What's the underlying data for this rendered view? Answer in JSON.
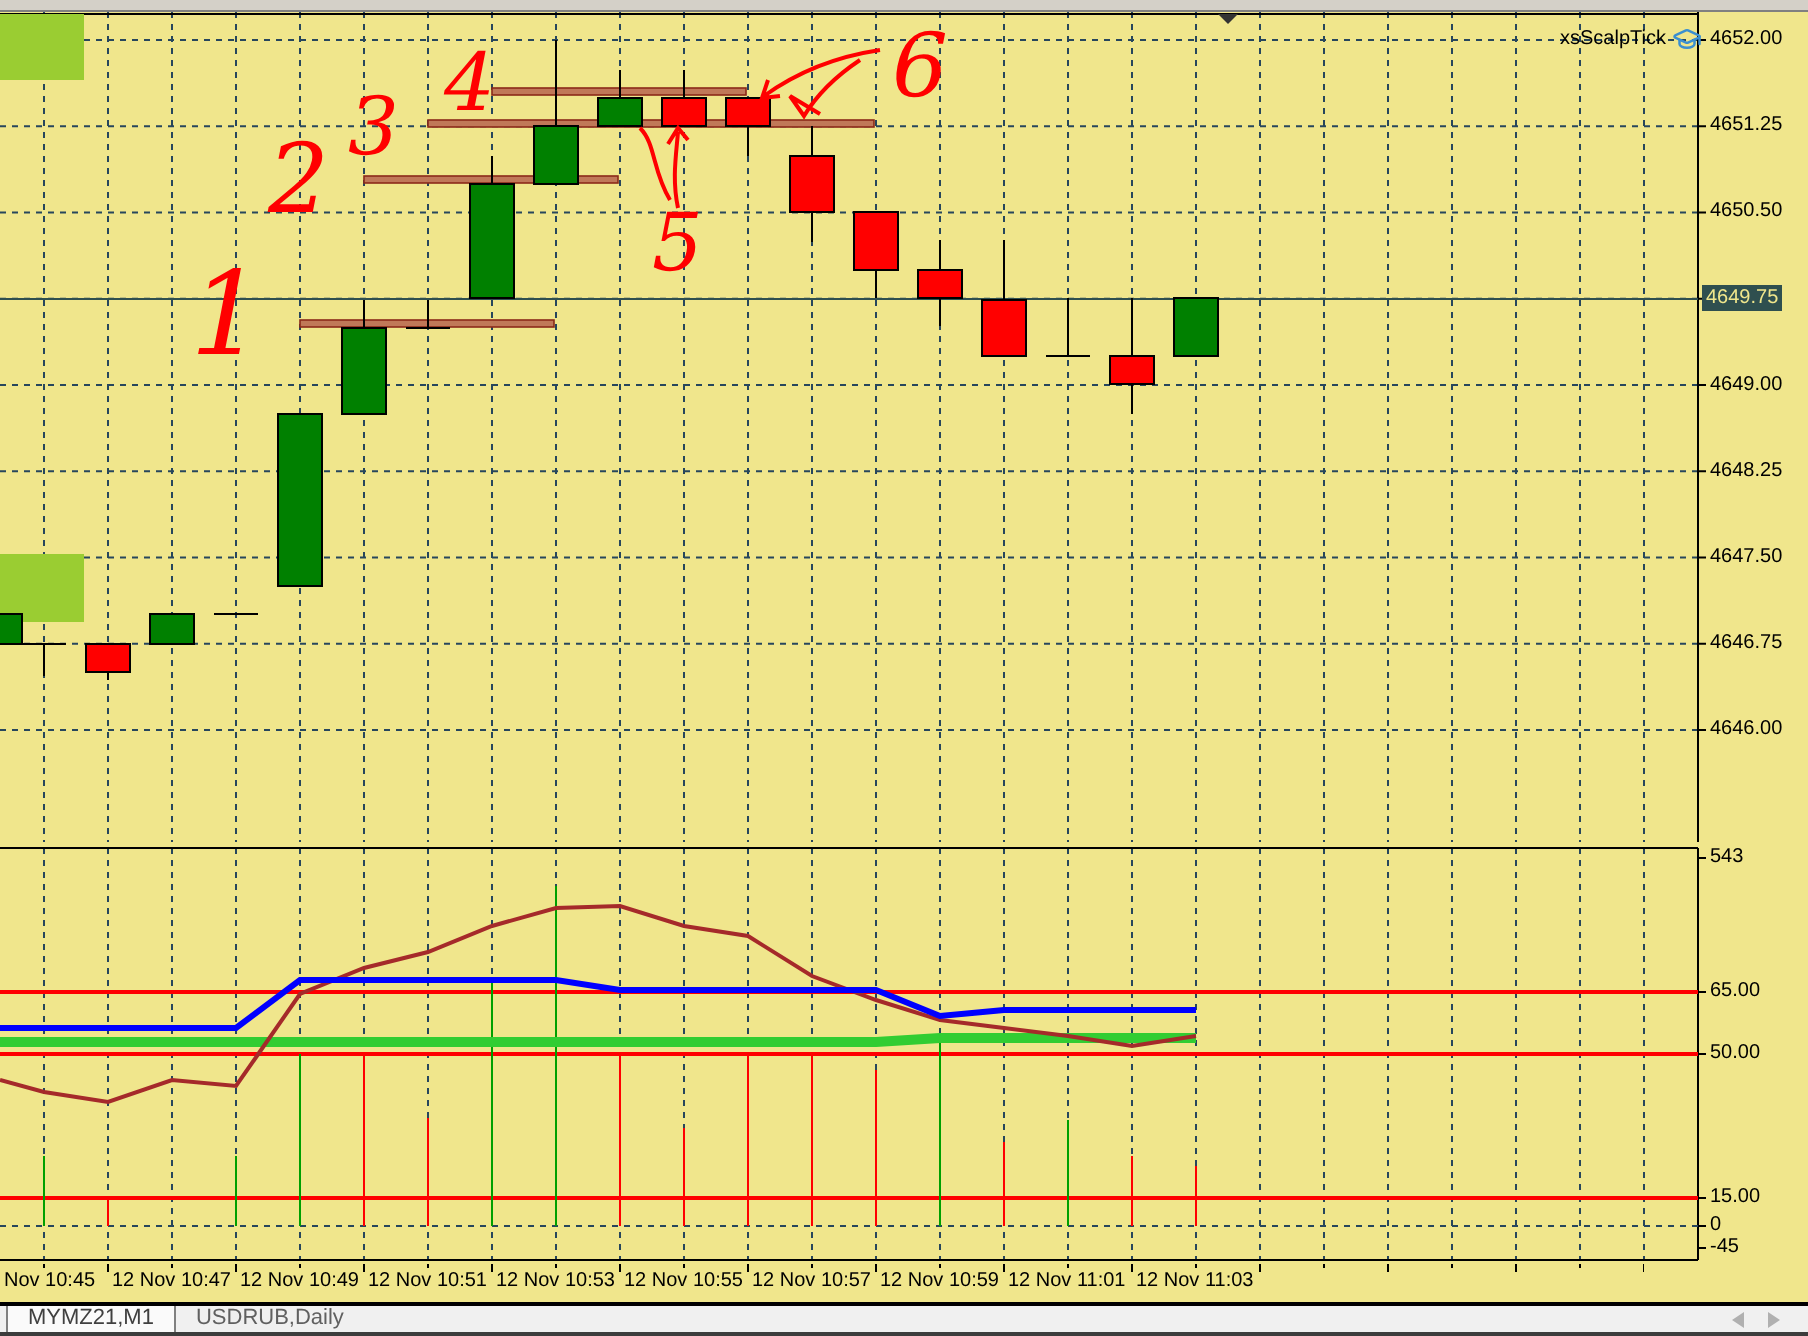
{
  "indicator": {
    "name": "xsScalpTick"
  },
  "price_axis": {
    "ticks": [
      {
        "label": "4652.00",
        "kind": "tick"
      },
      {
        "label": "4651.25",
        "kind": "tick"
      },
      {
        "label": "4650.50",
        "kind": "tick"
      },
      {
        "label": "4649.75",
        "kind": "current"
      },
      {
        "label": "4649.00",
        "kind": "tick"
      },
      {
        "label": "4648.25",
        "kind": "tick"
      },
      {
        "label": "4647.50",
        "kind": "tick"
      },
      {
        "label": "4646.75",
        "kind": "tick"
      },
      {
        "label": "4646.00",
        "kind": "tick"
      }
    ]
  },
  "annotations": [
    {
      "text": "1"
    },
    {
      "text": "2"
    },
    {
      "text": "3"
    },
    {
      "text": "4"
    },
    {
      "text": "5"
    },
    {
      "text": "6"
    }
  ],
  "indicator_axis": {
    "ticks": [
      {
        "label": "543",
        "kind": "plain"
      },
      {
        "label": "65.00",
        "kind": "level"
      },
      {
        "label": "50.00",
        "kind": "level"
      },
      {
        "label": "15.00",
        "kind": "level"
      },
      {
        "label": "0",
        "kind": "zero"
      },
      {
        "label": "-45",
        "kind": "plain"
      }
    ]
  },
  "time_axis": {
    "labels": [
      "Nov 10:45",
      "12 Nov 10:47",
      "12 Nov 10:49",
      "12 Nov 10:51",
      "12 Nov 10:53",
      "12 Nov 10:55",
      "12 Nov 10:57",
      "12 Nov 10:59",
      "12 Nov 11:01",
      "12 Nov 11:03"
    ]
  },
  "tabs": [
    {
      "label": "MYMZ21,M1",
      "selected": true
    },
    {
      "label": "USDRUB,Daily",
      "selected": false
    }
  ]
}
